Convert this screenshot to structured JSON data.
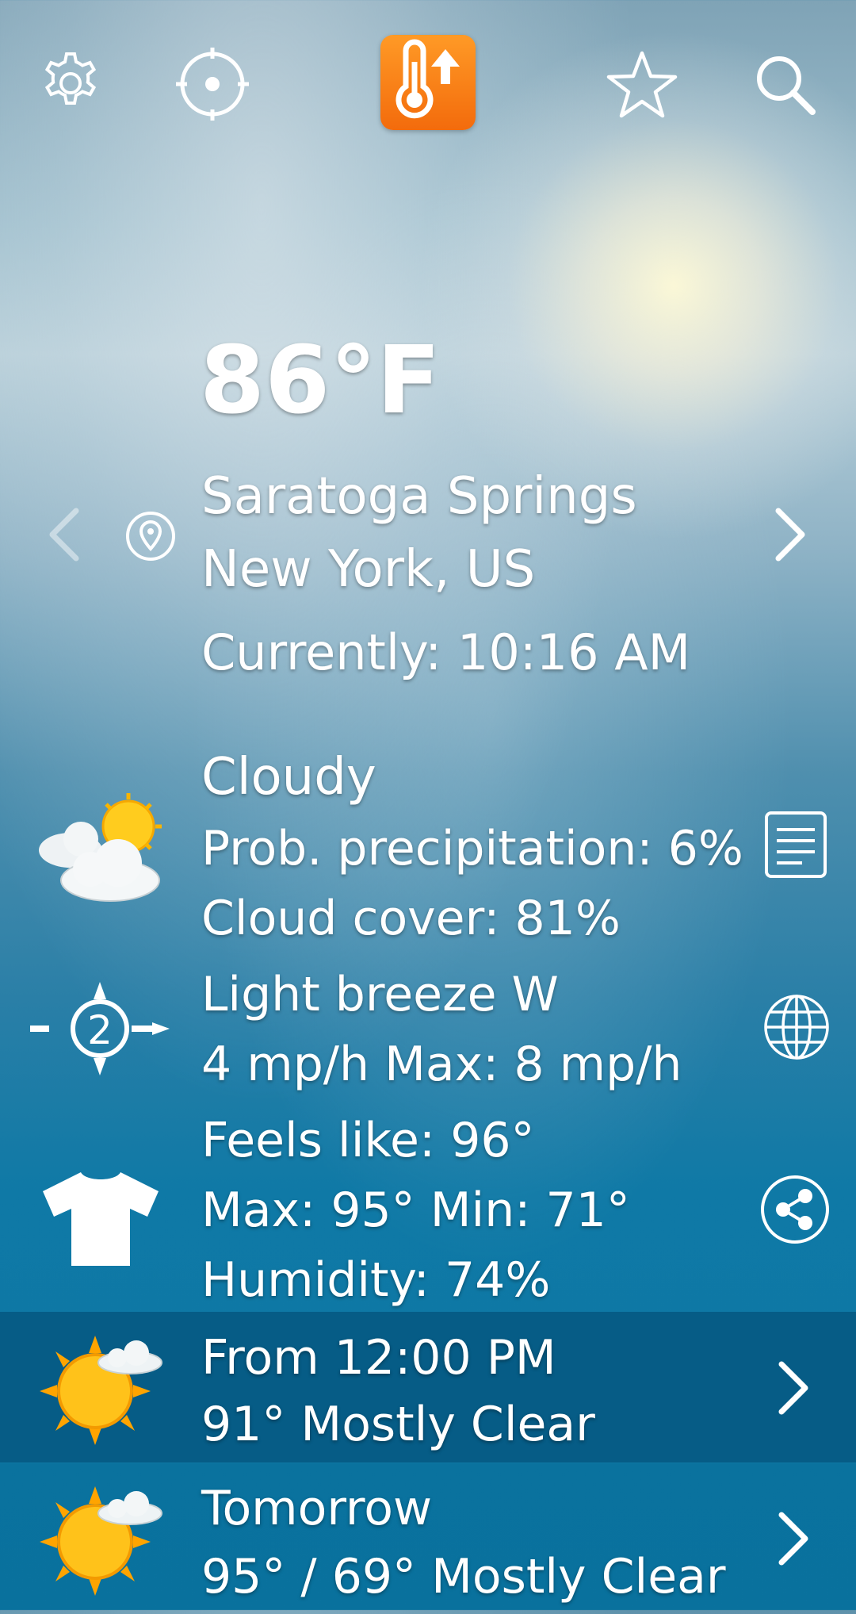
{
  "header": {
    "settings_icon": "gear-icon",
    "locate_icon": "crosshair-icon",
    "app_icon": "thermometer-up-icon",
    "favorite_icon": "star-icon",
    "search_icon": "search-icon",
    "accent_color": "#f47d14"
  },
  "current": {
    "temperature": "86°F",
    "city": "Saratoga Springs",
    "region": "New York, US",
    "time_label": "Currently: 10:16 AM"
  },
  "conditions": {
    "summary": "Cloudy",
    "precipitation": "Prob. precipitation: 6%",
    "cloud_cover": "Cloud cover: 81%",
    "wind": "Light breeze W",
    "wind_speed": "4 mp/h Max: 8 mp/h",
    "wind_force": "2",
    "feels_like": "Feels like: 96°",
    "max_min": "Max: 95° Min: 71°",
    "humidity": "Humidity: 74%"
  },
  "forecast": [
    {
      "title": "From 12:00 PM",
      "detail": "91° Mostly Clear"
    },
    {
      "title": "Tomorrow",
      "detail": "95° / 69° Mostly Clear"
    }
  ]
}
